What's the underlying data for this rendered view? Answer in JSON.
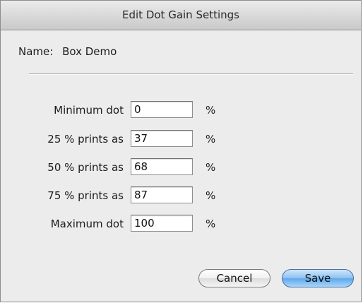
{
  "dialog": {
    "title": "Edit Dot Gain Settings",
    "name_label": "Name:",
    "name_value": "Box Demo"
  },
  "rows": [
    {
      "label": "Minimum dot",
      "value": "0",
      "unit": "%"
    },
    {
      "label": "25 % prints as",
      "value": "37",
      "unit": "%"
    },
    {
      "label": "50 % prints as",
      "value": "68",
      "unit": "%"
    },
    {
      "label": "75 % prints as",
      "value": "87",
      "unit": "%"
    },
    {
      "label": "Maximum dot",
      "value": "100",
      "unit": "%"
    }
  ],
  "buttons": {
    "cancel": "Cancel",
    "save": "Save"
  },
  "colors": {
    "window_bg": "#ececec",
    "default_button": "#5fa7ea"
  }
}
